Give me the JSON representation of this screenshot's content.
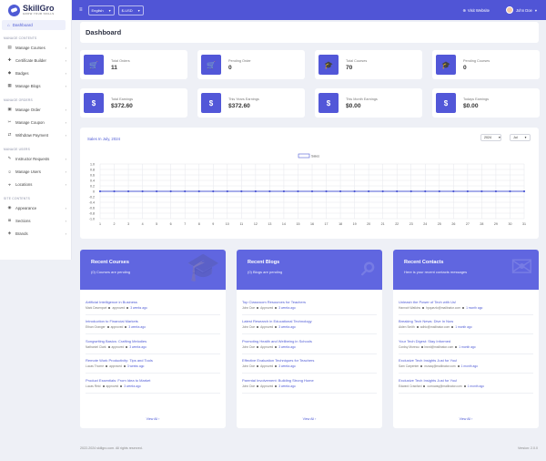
{
  "brand": {
    "name": "SkillGro",
    "tagline": "GROW YOUR SKILLS"
  },
  "topbar": {
    "language": "English",
    "currency": "$-USD",
    "visit_website": "Visit Website",
    "user_name": "John Doe"
  },
  "sidebar": {
    "active": "Dashboard",
    "sections": [
      {
        "title": "MANAGE CONTENTS",
        "items": [
          "Manage Courses",
          "Certificate Builder",
          "Badges",
          "Manage Blogs"
        ]
      },
      {
        "title": "MANAGE ORDERS",
        "items": [
          "Manage Order",
          "Manage Coupon",
          "Withdraw Payment"
        ]
      },
      {
        "title": "MANAGE USERS",
        "items": [
          "Instructor Requests",
          "Manage Users",
          "Locations"
        ]
      },
      {
        "title": "SITE CONTENTS",
        "items": [
          "Appearance",
          "Sections",
          "Brands"
        ]
      }
    ]
  },
  "page_title": "Dashboard",
  "stats": [
    {
      "label": "Total Orders",
      "value": "11",
      "icon": "cart-icon"
    },
    {
      "label": "Pending Order",
      "value": "0",
      "icon": "cart-icon"
    },
    {
      "label": "Total Courses",
      "value": "70",
      "icon": "graduation-cap-icon"
    },
    {
      "label": "Pending Courses",
      "value": "0",
      "icon": "graduation-cap-icon"
    },
    {
      "label": "Total Earnings",
      "value": "$372.60",
      "icon": "dollar-icon"
    },
    {
      "label": "This Years Earnings",
      "value": "$372.60",
      "icon": "dollar-icon"
    },
    {
      "label": "This Month Earnings",
      "value": "$0.00",
      "icon": "dollar-icon"
    },
    {
      "label": "Todays Earnings",
      "value": "$0.00",
      "icon": "dollar-icon"
    }
  ],
  "chart_card": {
    "title": "Sales In July, 2024",
    "year": "2024",
    "month": "Jul"
  },
  "chart_data": {
    "type": "line",
    "legend": "Sales",
    "legend_position": "top-center",
    "x": [
      1,
      2,
      3,
      4,
      5,
      6,
      7,
      8,
      9,
      10,
      11,
      12,
      13,
      14,
      15,
      16,
      17,
      18,
      19,
      20,
      21,
      22,
      23,
      24,
      25,
      26,
      27,
      28,
      29,
      30,
      31
    ],
    "values": [
      0,
      0,
      0,
      0,
      0,
      0,
      0,
      0,
      0,
      0,
      0,
      0,
      0,
      0,
      0,
      0,
      0,
      0,
      0,
      0,
      0,
      0,
      0,
      0,
      0,
      0,
      0,
      0,
      0,
      0,
      0
    ],
    "y_ticks": [
      "1.0",
      "0.8",
      "0.6",
      "0.4",
      "0.2",
      "0",
      "-0.2",
      "-0.4",
      "-0.6",
      "-0.8",
      "-1.0"
    ],
    "ylim": [
      -1,
      1
    ],
    "grid": true,
    "color": "#4f5bd5"
  },
  "cards": [
    {
      "title": "Recent Courses",
      "subtitle": "(0) Courses are pending",
      "items": [
        {
          "title": "Artificial Intelligence in Business",
          "who": "Mark Davenport",
          "status": "approved",
          "ago": "3 weeks ago"
        },
        {
          "title": "Introduction to Financial Markets",
          "who": "Ethan Granger",
          "status": "approved",
          "ago": "3 weeks ago"
        },
        {
          "title": "Songwriting Basics: Crafting Melodies",
          "who": "Nathaniel Clark",
          "status": "approved",
          "ago": "3 weeks ago"
        },
        {
          "title": "Remote Work Productivity: Tips and Tools",
          "who": "Lucas Thorne",
          "status": "approved",
          "ago": "3 weeks ago"
        },
        {
          "title": "Product Essentials: From Idea to Market",
          "who": "Lucas Reid",
          "status": "approved",
          "ago": "3 weeks ago"
        }
      ],
      "view_all": "View All"
    },
    {
      "title": "Recent Blogs",
      "subtitle": "(0) Blogs are pending",
      "items": [
        {
          "title": "Top Classroom Resources for Teachers",
          "who": "John Doe",
          "status": "Approved",
          "ago": "3 weeks ago"
        },
        {
          "title": "Latest Research in Educational Technology",
          "who": "John Doe",
          "status": "Approved",
          "ago": "3 weeks ago"
        },
        {
          "title": "Promoting Health and Wellbeing in Schools",
          "who": "John Doe",
          "status": "Approved",
          "ago": "3 weeks ago"
        },
        {
          "title": "Effective Evaluation Techniques for Teachers",
          "who": "John Doe",
          "status": "Approved",
          "ago": "3 weeks ago"
        },
        {
          "title": "Parental Involvement: Building Strong Home",
          "who": "John Doe",
          "status": "Approved",
          "ago": "3 weeks ago"
        }
      ],
      "view_all": "View All"
    },
    {
      "title": "Recent Contacts",
      "subtitle": "Here is your recent contacts messages",
      "items": [
        {
          "title": "Unleash the Power of Tech with Us!",
          "who": "Hannah Watkins",
          "status": "hpquezlo@mailinator.com",
          "ago": "1 month ago"
        },
        {
          "title": "Breaking Tech News: Dive In Now",
          "who": "Aiden Smith",
          "status": "adhic@mailinator.com",
          "ago": "1 month ago"
        },
        {
          "title": "Your Tech Digest: Stay Informed",
          "who": "Cordsy Moreau",
          "status": "bwrd@mailinator.com",
          "ago": "1 month ago"
        },
        {
          "title": "Exclusive Tech Insights Just for You!",
          "who": "Sam Carpenter",
          "status": "mzzaq@mailinator.com",
          "ago": "1 month ago"
        },
        {
          "title": "Exclusive Tech Insights Just for You!",
          "who": "Edward Crawford",
          "status": "currowaq@mailinator.com",
          "ago": "1 month ago"
        }
      ],
      "view_all": "View All"
    }
  ],
  "footer": {
    "copyright": "2022-2024 skillgro.com. All rights reserved.",
    "version": "Version: 2.0.0"
  }
}
